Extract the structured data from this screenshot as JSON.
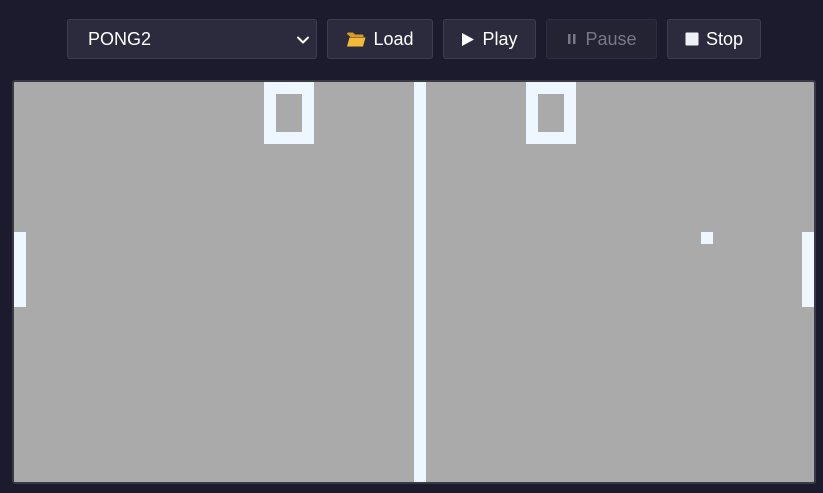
{
  "toolbar": {
    "rom_select": {
      "value": "PONG2"
    },
    "load_label": "Load",
    "play_label": "Play",
    "pause_label": "Pause",
    "stop_label": "Stop",
    "pause_enabled": false
  },
  "icons": {
    "rom_select": "chevron-down-icon",
    "load": "folder-icon",
    "play": "play-icon",
    "pause": "pause-icon",
    "stop": "stop-icon"
  },
  "colors": {
    "page_background": "#1b1b2d",
    "button_background": "#2b2b3d",
    "screen_background": "#aaaaaa",
    "game_foreground": "#eef6ff",
    "folder_icon": "#f5b93a"
  },
  "game": {
    "left_score": "0",
    "right_score": "0"
  }
}
